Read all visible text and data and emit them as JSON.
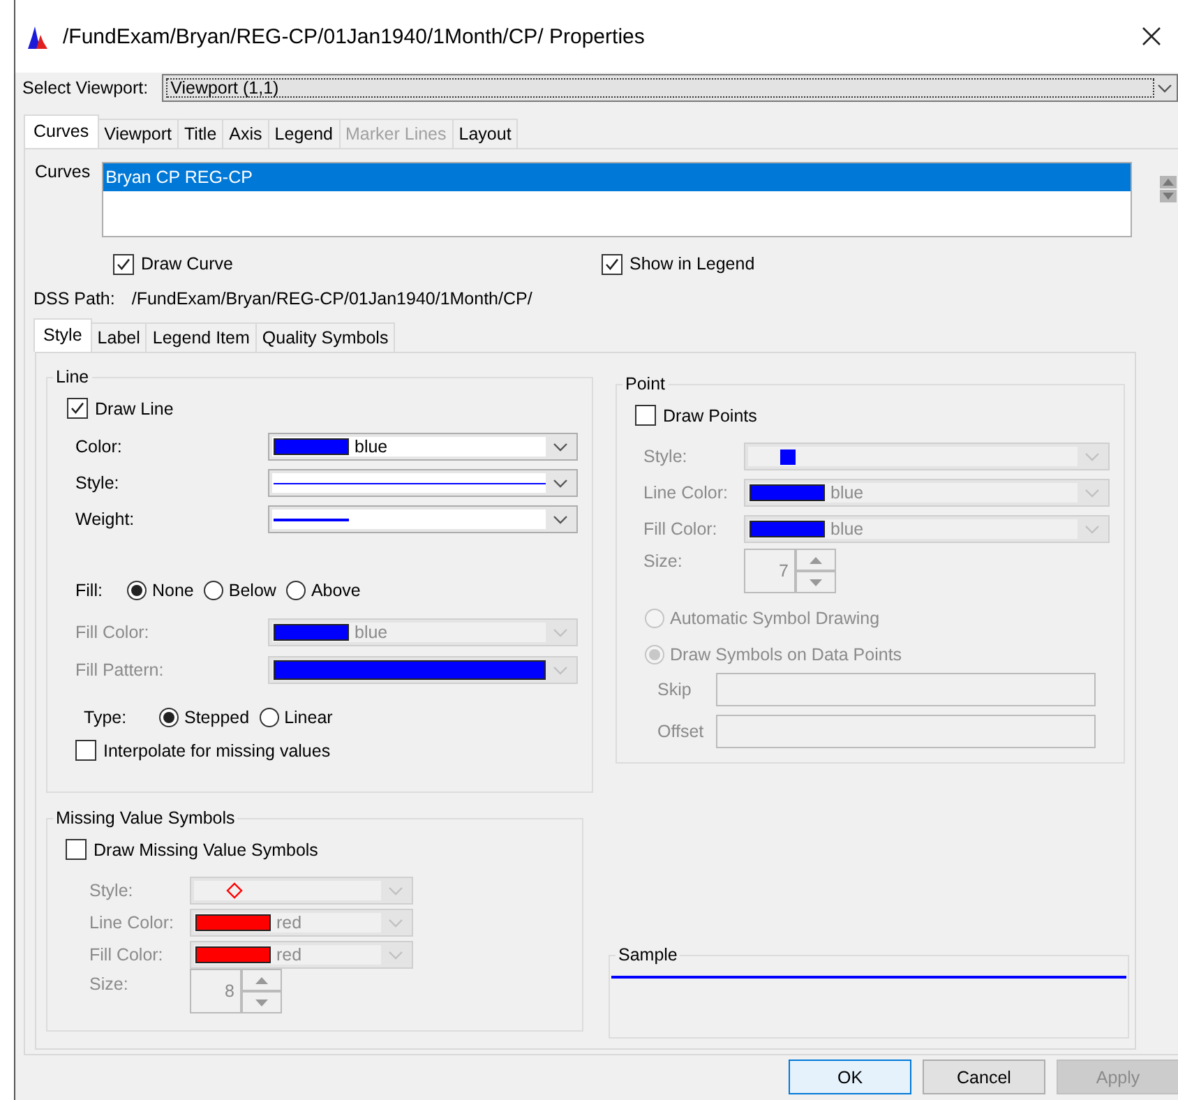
{
  "window": {
    "title": "/FundExam/Bryan/REG-CP/01Jan1940/1Month/CP/ Properties"
  },
  "viewport_select": {
    "label": "Select Viewport:",
    "value": "Viewport (1,1)"
  },
  "tabs": [
    {
      "label": "Curves",
      "selected": true,
      "disabled": false
    },
    {
      "label": "Viewport",
      "selected": false,
      "disabled": false
    },
    {
      "label": "Title",
      "selected": false,
      "disabled": false
    },
    {
      "label": "Axis",
      "selected": false,
      "disabled": false
    },
    {
      "label": "Legend",
      "selected": false,
      "disabled": false
    },
    {
      "label": "Marker Lines",
      "selected": false,
      "disabled": true
    },
    {
      "label": "Layout",
      "selected": false,
      "disabled": false
    }
  ],
  "curves": {
    "label": "Curves",
    "items": [
      {
        "label": "Bryan CP REG-CP",
        "selected": true
      }
    ]
  },
  "draw_curve": {
    "label": "Draw Curve",
    "checked": true
  },
  "show_in_legend": {
    "label": "Show in Legend",
    "checked": true
  },
  "dss_path": {
    "label": "DSS Path:",
    "value": "/FundExam/Bryan/REG-CP/01Jan1940/1Month/CP/"
  },
  "style_tabs": [
    {
      "label": "Style",
      "selected": true
    },
    {
      "label": "Label",
      "selected": false
    },
    {
      "label": "Legend Item",
      "selected": false
    },
    {
      "label": "Quality Symbols",
      "selected": false
    }
  ],
  "line": {
    "title": "Line",
    "draw_line": {
      "label": "Draw Line",
      "checked": true
    },
    "rows": [
      {
        "label": "Color:",
        "kind": "color",
        "color": "#0000ff",
        "value": "blue",
        "disabled": false
      },
      {
        "label": "Style:",
        "kind": "line",
        "color": "#0000ff",
        "disabled": false
      },
      {
        "label": "Weight:",
        "kind": "weight",
        "color": "#0000ff",
        "disabled": false
      }
    ],
    "fill": {
      "label": "Fill:",
      "options": [
        {
          "label": "None",
          "selected": true
        },
        {
          "label": "Below",
          "selected": false
        },
        {
          "label": "Above",
          "selected": false
        }
      ]
    },
    "fill_rows": [
      {
        "label": "Fill Color:",
        "kind": "color",
        "color": "#0000ff",
        "value": "blue",
        "disabled": true
      },
      {
        "label": "Fill Pattern:",
        "kind": "pattern",
        "color": "#0000ff",
        "disabled": true
      }
    ],
    "type": {
      "label": "Type:",
      "options": [
        {
          "label": "Stepped",
          "selected": true
        },
        {
          "label": "Linear",
          "selected": false
        }
      ]
    },
    "interpolate": {
      "label": "Interpolate for missing values",
      "checked": false
    }
  },
  "point": {
    "title": "Point",
    "draw_points": {
      "label": "Draw Points",
      "checked": false
    },
    "rows": [
      {
        "label": "Style:",
        "kind": "square",
        "color": "#0000ff",
        "disabled": true
      },
      {
        "label": "Line Color:",
        "kind": "color",
        "color": "#0000ff",
        "value": "blue",
        "disabled": true
      },
      {
        "label": "Fill Color:",
        "kind": "color",
        "color": "#0000ff",
        "value": "blue",
        "disabled": true
      }
    ],
    "size": {
      "label": "Size:",
      "value": "7",
      "disabled": true
    },
    "modes": [
      {
        "label": "Automatic Symbol Drawing",
        "selected": false,
        "disabled": true
      },
      {
        "label": "Draw Symbols on Data Points",
        "selected": true,
        "disabled": true
      }
    ],
    "fields": [
      {
        "label": "Skip",
        "disabled": true
      },
      {
        "label": "Offset",
        "disabled": true
      }
    ]
  },
  "missing": {
    "title": "Missing Value Symbols",
    "draw_missing": {
      "label": "Draw Missing Value Symbols",
      "checked": false
    },
    "rows": [
      {
        "label": "Style:",
        "kind": "diamond",
        "color": "#ff0000",
        "disabled": true
      },
      {
        "label": "Line Color:",
        "kind": "color",
        "color": "#ff0000",
        "value": "red",
        "disabled": true
      },
      {
        "label": "Fill Color:",
        "kind": "color",
        "color": "#ff0000",
        "value": "red",
        "disabled": true
      }
    ],
    "size": {
      "label": "Size:",
      "value": "8",
      "disabled": true
    }
  },
  "sample": {
    "title": "Sample",
    "color": "#0000ff"
  },
  "buttons": [
    {
      "label": "OK",
      "default": true,
      "disabled": false
    },
    {
      "label": "Cancel",
      "default": false,
      "disabled": false
    },
    {
      "label": "Apply",
      "default": false,
      "disabled": true
    }
  ]
}
